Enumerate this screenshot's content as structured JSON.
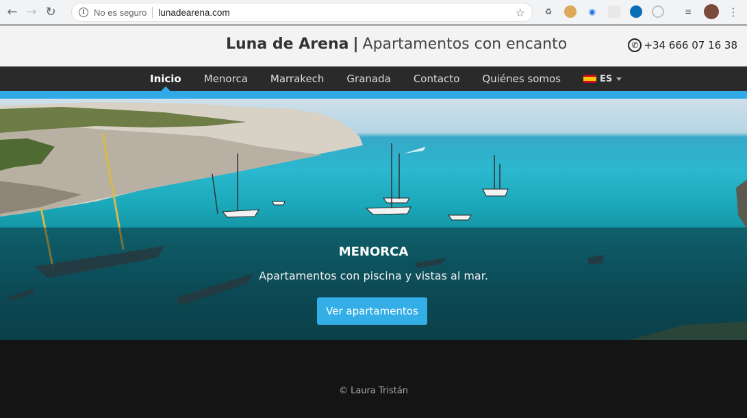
{
  "browser": {
    "security_label": "No es seguro",
    "url": "lunadearena.com"
  },
  "header": {
    "brand_name": "Luna de Arena",
    "separator": "|",
    "tagline": "Apartamentos con encanto",
    "phone": "+34 666 07 16 38"
  },
  "nav": {
    "items": [
      {
        "label": "Inicio",
        "active": true
      },
      {
        "label": "Menorca"
      },
      {
        "label": "Marrakech"
      },
      {
        "label": "Granada"
      },
      {
        "label": "Contacto"
      },
      {
        "label": "Quiénes somos"
      }
    ],
    "language": "ES"
  },
  "hero": {
    "title": "MENORCA",
    "subtitle": "Apartamentos con piscina y vistas al mar.",
    "button_label": "Ver apartamentos"
  },
  "footer": {
    "copyright": "© Laura Tristán"
  },
  "colors": {
    "accent": "#30a9e6",
    "nav_bg": "#2a2a2a",
    "footer_bg": "#141414"
  }
}
